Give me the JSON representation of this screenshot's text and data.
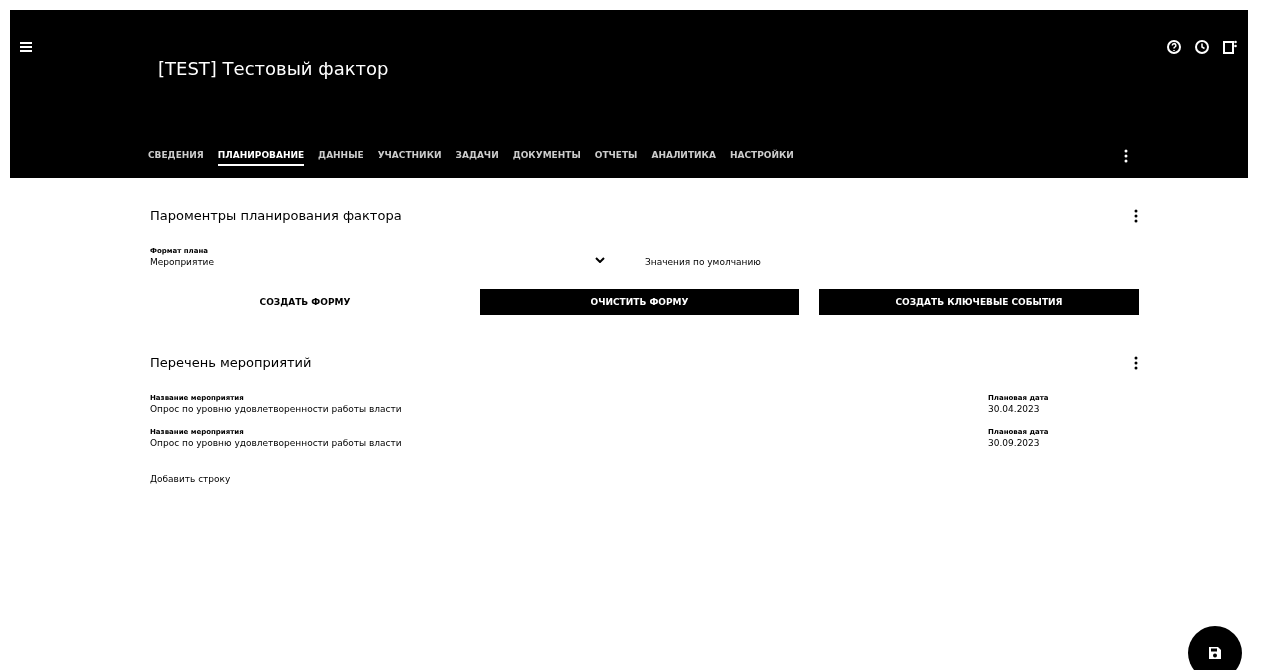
{
  "header": {
    "title": "[TEST] Тестовый фактор"
  },
  "tabs": [
    {
      "label": "СВЕДЕНИЯ",
      "selected": false
    },
    {
      "label": "ПЛАНИРОВАНИЕ",
      "selected": true
    },
    {
      "label": "ДАННЫЕ",
      "selected": false
    },
    {
      "label": "УЧАСТНИКИ",
      "selected": false
    },
    {
      "label": "ЗАДАЧИ",
      "selected": false
    },
    {
      "label": "ДОКУМЕНТЫ",
      "selected": false
    },
    {
      "label": "ОТЧЕТЫ",
      "selected": false
    },
    {
      "label": "АНАЛИТИКА",
      "selected": false
    },
    {
      "label": "НАСТРОЙКИ",
      "selected": false
    }
  ],
  "planning": {
    "title": "Пароментры планирования фактора",
    "format_field": {
      "label": "Формат плана",
      "value": "Мероприятие"
    },
    "default_label": "Значения по умолчанию",
    "buttons": [
      {
        "label": "СОЗДАТЬ ФОРМУ",
        "kind": "text"
      },
      {
        "label": "ОЧИСТИТЬ ФОРМУ",
        "kind": "filled"
      },
      {
        "label": "СОЗДАТЬ КЛЮЧЕВЫЕ СОБЫТИЯ",
        "kind": "filled"
      }
    ]
  },
  "events": {
    "title": "Перечень мероприятий",
    "rows": [
      {
        "name_label": "Название мероприятия",
        "name": "Опрос по уровню удовлетворенности работы власти",
        "date_label": "Плановая дата",
        "date": "30.04.2023"
      },
      {
        "name_label": "Название мероприятия",
        "name": "Опрос по уровню удовлетворенности работы власти",
        "date_label": "Плановая дата",
        "date": "30.09.2023"
      }
    ],
    "add_row": "Добавить строку"
  }
}
